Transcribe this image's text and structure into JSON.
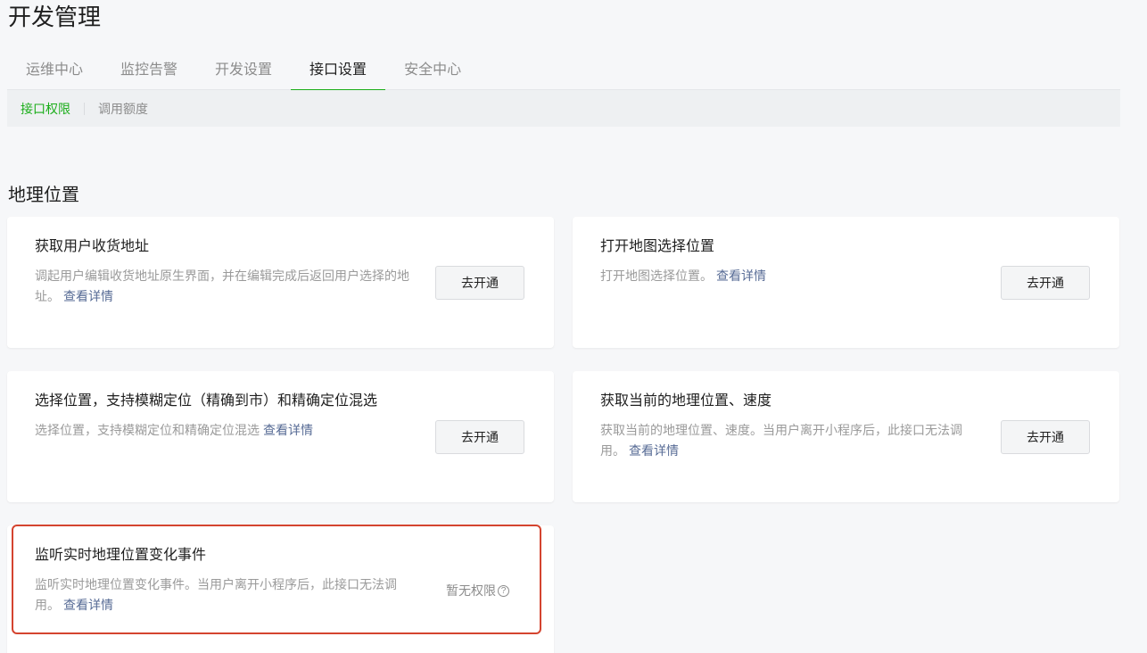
{
  "page": {
    "title": "开发管理"
  },
  "tabs": [
    {
      "label": "运维中心"
    },
    {
      "label": "监控告警"
    },
    {
      "label": "开发设置"
    },
    {
      "label": "接口设置"
    },
    {
      "label": "安全中心"
    }
  ],
  "active_tab": "接口设置",
  "subnav": [
    {
      "label": "接口权限"
    },
    {
      "label": "调用额度"
    }
  ],
  "section": {
    "title": "地理位置"
  },
  "detail_link": "查看详情",
  "cards": [
    {
      "title": "获取用户收货地址",
      "desc": "调起用户编辑收货地址原生界面，并在编辑完成后返回用户选择的地址。",
      "button": "去开通"
    },
    {
      "title": "打开地图选择位置",
      "desc": "打开地图选择位置。",
      "button": "去开通"
    },
    {
      "title": "选择位置，支持模糊定位（精确到市）和精确定位混选",
      "desc": "选择位置，支持模糊定位和精确定位混选",
      "button": "去开通"
    },
    {
      "title": "获取当前的地理位置、速度",
      "desc": "获取当前的地理位置、速度。当用户离开小程序后，此接口无法调用。",
      "button": "去开通"
    },
    {
      "title": "监听实时地理位置变化事件",
      "desc": "监听实时地理位置变化事件。当用户离开小程序后，此接口无法调用。",
      "status": "暂无权限",
      "status_icon": "question-circle-icon"
    }
  ],
  "colors": {
    "accent": "#1aad19",
    "link": "#576b95",
    "highlight": "#d4442f"
  }
}
